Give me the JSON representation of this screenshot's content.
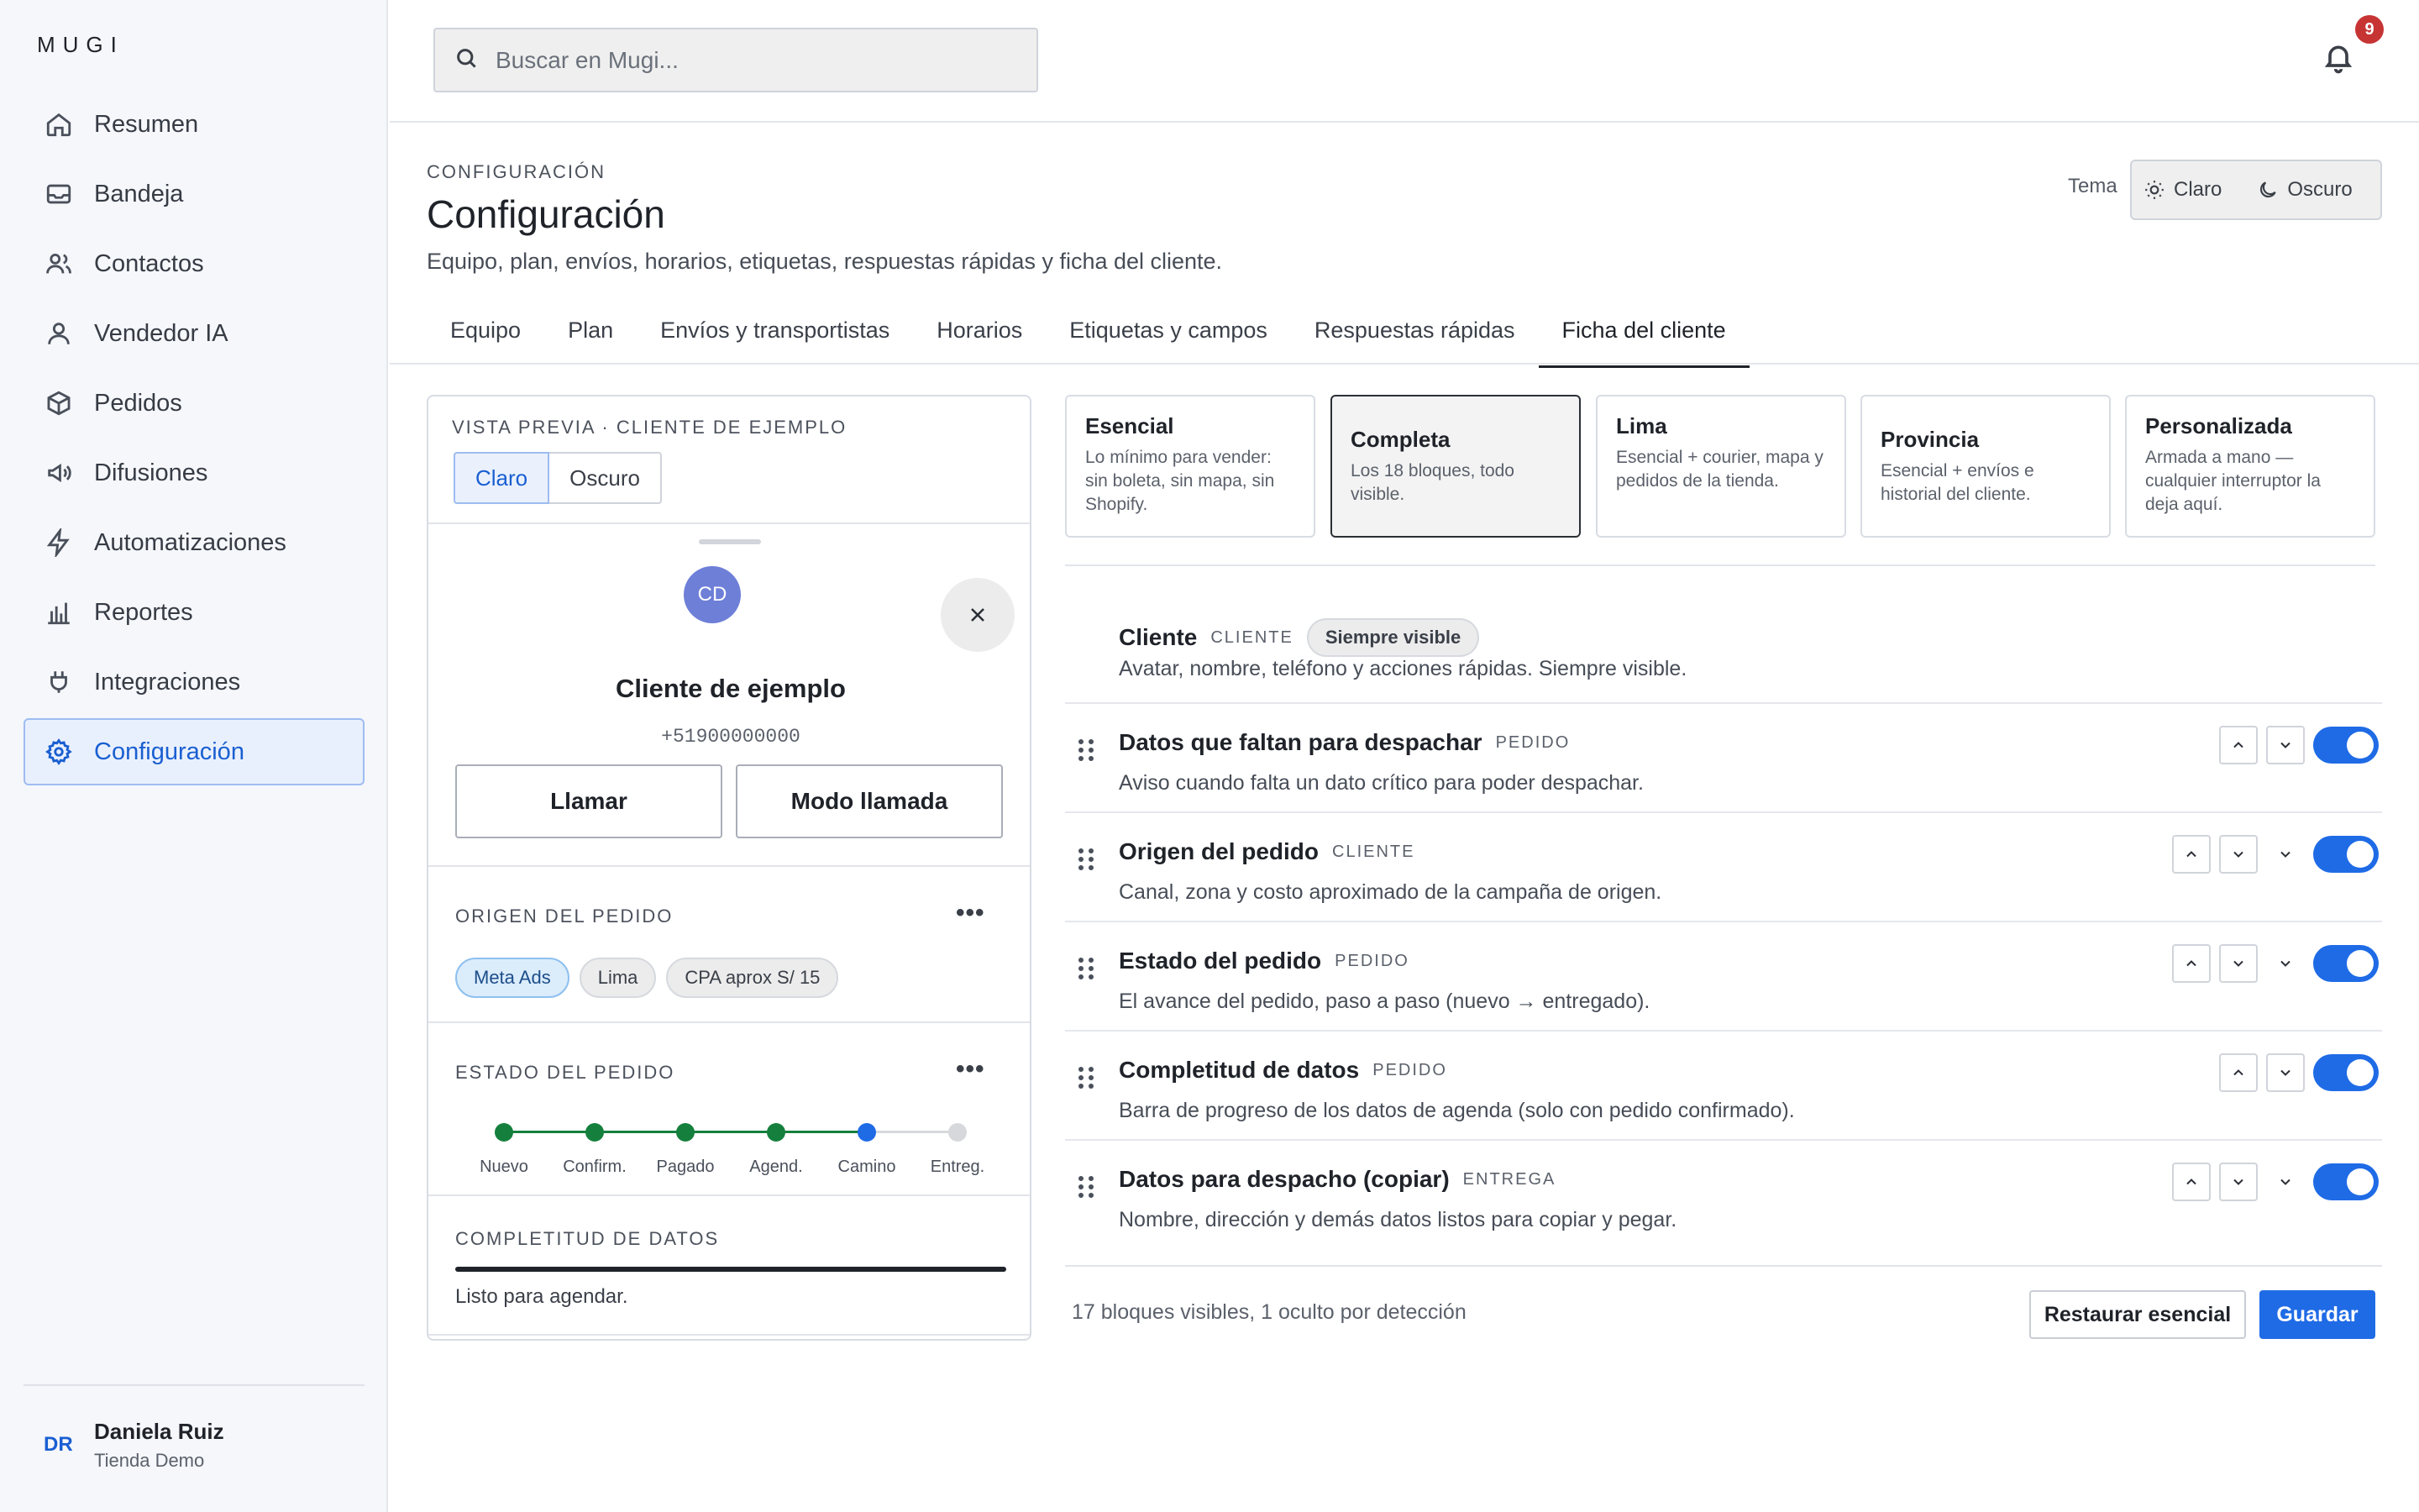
{
  "app": {
    "brand": "MUGI"
  },
  "sidebar": {
    "items": [
      {
        "label": "Resumen",
        "icon": "home-icon"
      },
      {
        "label": "Bandeja",
        "icon": "inbox-icon"
      },
      {
        "label": "Contactos",
        "icon": "users-icon"
      },
      {
        "label": "Vendedor IA",
        "icon": "user-icon"
      },
      {
        "label": "Pedidos",
        "icon": "box-icon"
      },
      {
        "label": "Difusiones",
        "icon": "megaphone-icon"
      },
      {
        "label": "Automatizaciones",
        "icon": "bolt-icon"
      },
      {
        "label": "Reportes",
        "icon": "bar-chart-icon"
      },
      {
        "label": "Integraciones",
        "icon": "plug-icon"
      },
      {
        "label": "Configuración",
        "icon": "gear-icon",
        "active": true
      }
    ],
    "user": {
      "initials": "DR",
      "name": "Daniela Ruiz",
      "store": "Tienda Demo"
    }
  },
  "topbar": {
    "search_placeholder": "Buscar en Mugi...",
    "notifications_count": "9"
  },
  "header": {
    "eyebrow": "CONFIGURACIÓN",
    "title": "Configuración",
    "subtitle": "Equipo, plan, envíos, horarios, etiquetas, respuestas rápidas y ficha del cliente.",
    "theme_label": "Tema",
    "theme_options": [
      "Claro",
      "Oscuro"
    ]
  },
  "tabs": [
    {
      "label": "Equipo"
    },
    {
      "label": "Plan"
    },
    {
      "label": "Envíos y transportistas"
    },
    {
      "label": "Horarios"
    },
    {
      "label": "Etiquetas y campos"
    },
    {
      "label": "Respuestas rápidas"
    },
    {
      "label": "Ficha del cliente",
      "active": true
    }
  ],
  "preview": {
    "heading": "VISTA PREVIA · CLIENTE DE EJEMPLO",
    "mode_options": [
      "Claro",
      "Oscuro"
    ],
    "mode_selected": "Claro",
    "avatar_initials": "CD",
    "customer_name": "Cliente de ejemplo",
    "customer_phone": "+51900000000",
    "call_button": "Llamar",
    "call_mode_button": "Modo llamada",
    "origin": {
      "title": "ORIGEN DEL PEDIDO",
      "more": "•••",
      "chips": [
        "Meta Ads",
        "Lima",
        "CPA aprox  S/ 15"
      ]
    },
    "status": {
      "title": "ESTADO DEL PEDIDO",
      "more": "•••",
      "steps": [
        {
          "label": "Nuevo",
          "state": "done"
        },
        {
          "label": "Confirm.",
          "state": "done"
        },
        {
          "label": "Pagado",
          "state": "done"
        },
        {
          "label": "Agend.",
          "state": "done"
        },
        {
          "label": "Camino",
          "state": "current"
        },
        {
          "label": "Entreg.",
          "state": "pending"
        }
      ],
      "colors": {
        "done": "#15803d",
        "current": "#1f6be6",
        "pending": "#d6d8dc"
      }
    },
    "completeness": {
      "title": "COMPLETITUD DE DATOS",
      "progress": 1.0,
      "status_text": "Listo para agendar."
    }
  },
  "presets": [
    {
      "title": "Esencial",
      "desc": "Lo mínimo para vender: sin boleta, sin mapa, sin Shopify."
    },
    {
      "title": "Completa",
      "desc": "Los 18 bloques, todo visible.",
      "active": true
    },
    {
      "title": "Lima",
      "desc": "Esencial + courier, mapa y pedidos de la tienda."
    },
    {
      "title": "Provincia",
      "desc": "Esencial + envíos e historial del cliente."
    },
    {
      "title": "Personalizada",
      "desc": "Armada a mano — cualquier interruptor la deja aquí."
    }
  ],
  "blocks": [
    {
      "title": "Cliente",
      "tag": "CLIENTE",
      "pill": "Siempre visible",
      "desc": "Avatar, nombre, teléfono y acciones rápidas. Siempre visible.",
      "fixed": true
    },
    {
      "title": "Datos que faltan para despachar",
      "tag": "PEDIDO",
      "desc": "Aviso cuando falta un dato crítico para poder despachar.",
      "enabled": true,
      "controls": "up-down"
    },
    {
      "title": "Origen del pedido",
      "tag": "CLIENTE",
      "desc": "Canal, zona y costo aproximado de la campaña de origen.",
      "enabled": true,
      "controls": "up-down-expand"
    },
    {
      "title": "Estado del pedido",
      "tag": "PEDIDO",
      "desc": "El avance del pedido, paso a paso (nuevo → entregado).",
      "enabled": true,
      "controls": "up-down-expand"
    },
    {
      "title": "Completitud de datos",
      "tag": "PEDIDO",
      "desc": "Barra de progreso de los datos de agenda (solo con pedido confirmado).",
      "enabled": true,
      "controls": "up-down"
    },
    {
      "title": "Datos para despacho (copiar)",
      "tag": "ENTREGA",
      "desc": "Nombre, dirección y demás datos listos para copiar y pegar.",
      "enabled": true,
      "controls": "up-down-expand"
    }
  ],
  "footer": {
    "summary": "17 bloques visibles, 1 oculto por detección",
    "restore_label": "Restaurar esencial",
    "save_label": "Guardar"
  },
  "colors": {
    "accent": "#1f6be6",
    "badge": "#c73434",
    "active_nav_bg": "#e9f0fd"
  }
}
